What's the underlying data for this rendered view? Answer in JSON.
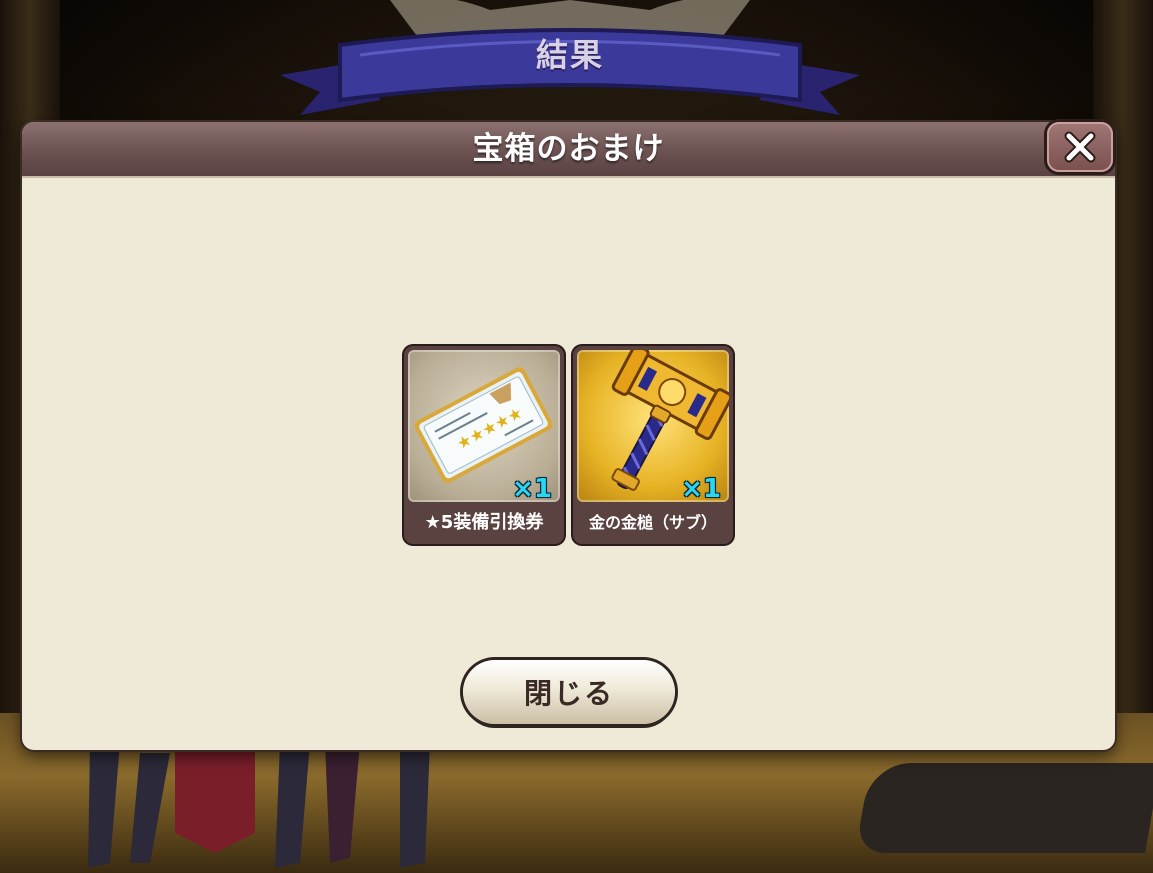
{
  "banner": {
    "title": "結果"
  },
  "dialog": {
    "title": "宝箱のおまけ",
    "close_icon": "close-x-icon"
  },
  "rewards": [
    {
      "name": "★5装備引換券",
      "quantity": "×1",
      "icon": "ticket-icon",
      "rarity_frame": "silver"
    },
    {
      "name": "金の金槌（サブ）",
      "quantity": "×1",
      "icon": "golden-hammer-icon",
      "rarity_frame": "gold"
    }
  ],
  "footer": {
    "close_label": "閉じる"
  },
  "colors": {
    "dialog_bg": "#efe9d8",
    "header": "#6e5453",
    "quantity": "#2bd7f0",
    "banner_ribbon": "#3b3a9a"
  }
}
